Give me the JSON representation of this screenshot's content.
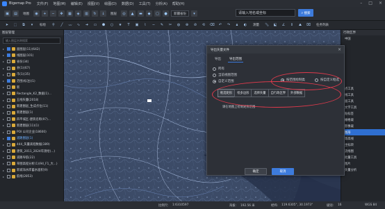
{
  "app": {
    "title": "Bigemap Pro",
    "menu": [
      "文件(F)",
      "地图(M)",
      "编辑(E)",
      "视图(V)",
      "绘图(D)",
      "数据(D)",
      "工具(T)",
      "分析(A)",
      "帮助(H)"
    ]
  },
  "toolbar": {
    "map_label": "地图",
    "layer_label": "图层",
    "region_select": "新疆省份",
    "search_placeholder": "请输入地名或坐标",
    "search_button": "搜索",
    "tag_label": "标绘",
    "measure_label": "测量",
    "task_label": "任务列表"
  },
  "left_panel": {
    "title": "图层管理",
    "search_placeholder": "输入图层名称搜索",
    "items": [
      {
        "label": "面图层(11)(642)",
        "checked": true
      },
      {
        "label": "线图层(101)",
        "checked": true
      },
      {
        "label": "省份(34)",
        "checked": false
      },
      {
        "label": "县(1)(67)",
        "checked": false
      },
      {
        "label": "市(1)(35)",
        "checked": false
      },
      {
        "label": "范围(标注)(1)",
        "checked": true
      },
      {
        "label": "新",
        "checked": false
      },
      {
        "label": "Rectangle_K2_数据(1)...",
        "checked": false
      },
      {
        "label": "五线矢量(2018)",
        "checked": false
      },
      {
        "label": "新建图层_生成点位(11)",
        "checked": false
      },
      {
        "label": "新建图层(1)",
        "checked": false
      },
      {
        "label": "四平城区-建筑名称(97)...",
        "checked": false
      },
      {
        "label": "新建图层(11)(1)",
        "checked": false
      },
      {
        "label": "POI 公司企业(18600)",
        "checked": false
      },
      {
        "label": "道路图层(1)",
        "checked": true,
        "selected": true
      },
      {
        "label": "444_矢量高程数据(389)",
        "checked": false
      },
      {
        "label": "建筑_2011_2024年测绘(...)",
        "checked": false
      },
      {
        "label": "道路导航(22)",
        "checked": false
      },
      {
        "label": "草图高程分析(1)(94_F1_大...)",
        "checked": false
      },
      {
        "label": "新城海水库蓄水面积(9)",
        "checked": false
      },
      {
        "label": "航线(2853)",
        "checked": false
      }
    ]
  },
  "right_panel": {
    "title": "行政区界",
    "items": [
      "中国",
      "",
      "",
      "",
      "",
      "",
      "",
      "",
      "点工具",
      "线工具",
      "面工具",
      "文字工具",
      "贴标签",
      "栅格裁",
      "影像裁",
      "图形",
      "等高线",
      "坐标转",
      "流线图",
      "批量工具",
      "图片",
      "矢量分析"
    ],
    "active_index": 15
  },
  "dialog": {
    "title": "导出矢量文件",
    "tabs": [
      "导出",
      "导出范围"
    ],
    "scope_options": [
      "所有",
      "当前视图范围",
      "自定义范围"
    ],
    "shape_options": [
      "按范围绘制类",
      "按自定义框选"
    ],
    "sub_tabs": [
      "框选矩形",
      "绘多边形",
      "选择矢量",
      "自行政区界",
      "外部数据"
    ],
    "hint": "请在地图上绘制矩形范围",
    "ok": "确定",
    "cancel": "取消"
  },
  "status": {
    "scale_label": "比例尺:",
    "scale_value": "1:6310597",
    "altitude_label": "海拔:",
    "altitude_value": "192.56 米",
    "coord_label": "经纬:",
    "coord_value": "119.6305°, 30.1973°",
    "zoom_label": "级别:",
    "zoom_value": "16",
    "crs": "WGS 84"
  },
  "colors": {
    "accent": "#3d7bdc",
    "annotation": "#e23a4c",
    "map_land": "#3b4a66"
  }
}
